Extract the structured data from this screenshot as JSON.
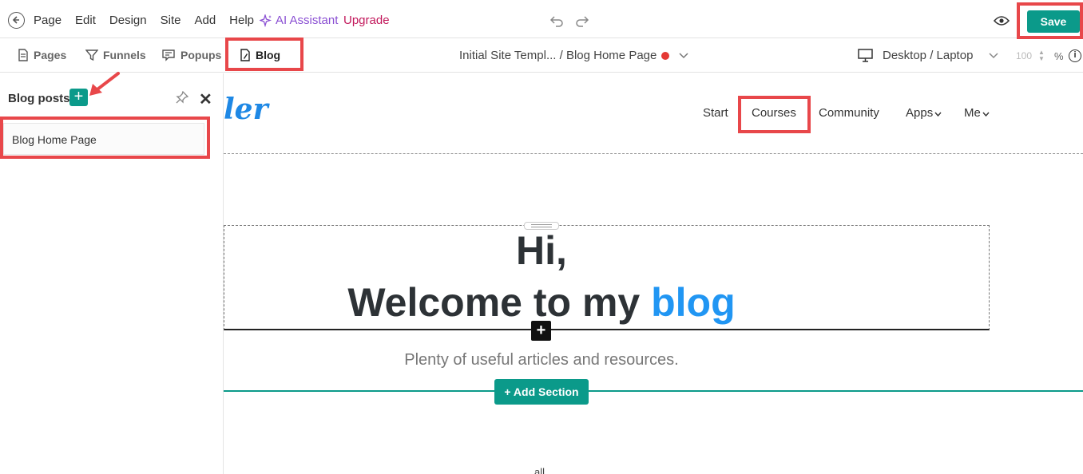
{
  "topbar": {
    "menu": [
      "Page",
      "Edit",
      "Design",
      "Site",
      "Add",
      "Help"
    ],
    "ai_assistant": "AI Assistant",
    "upgrade": "Upgrade",
    "save": "Save"
  },
  "toolbar": {
    "tabs": [
      "Pages",
      "Funnels",
      "Popups",
      "Blog"
    ],
    "breadcrumb": "Initial Site Templ... / Blog Home Page",
    "device": "Desktop / Laptop",
    "zoom": "100",
    "zoom_unit": "%",
    "info": "i"
  },
  "panel": {
    "title": "Blog posts",
    "items": [
      "Blog Home Page"
    ]
  },
  "site": {
    "logo": "ler",
    "nav": [
      "Start",
      "Courses",
      "Community",
      "Apps",
      "Me"
    ],
    "hero_line1": "Hi,",
    "hero_line2": "Welcome to my ",
    "hero_highlight": "blog",
    "subtitle": "Plenty of useful articles and resources.",
    "add_section": "+ Add Section",
    "bottom_text": "all"
  },
  "colors": {
    "accent": "#0b9a8a",
    "highlight": "#e8474a",
    "blog_blue": "#2196f3",
    "ai_purple": "#8a4fd3",
    "upgrade_pink": "#c2185b"
  }
}
